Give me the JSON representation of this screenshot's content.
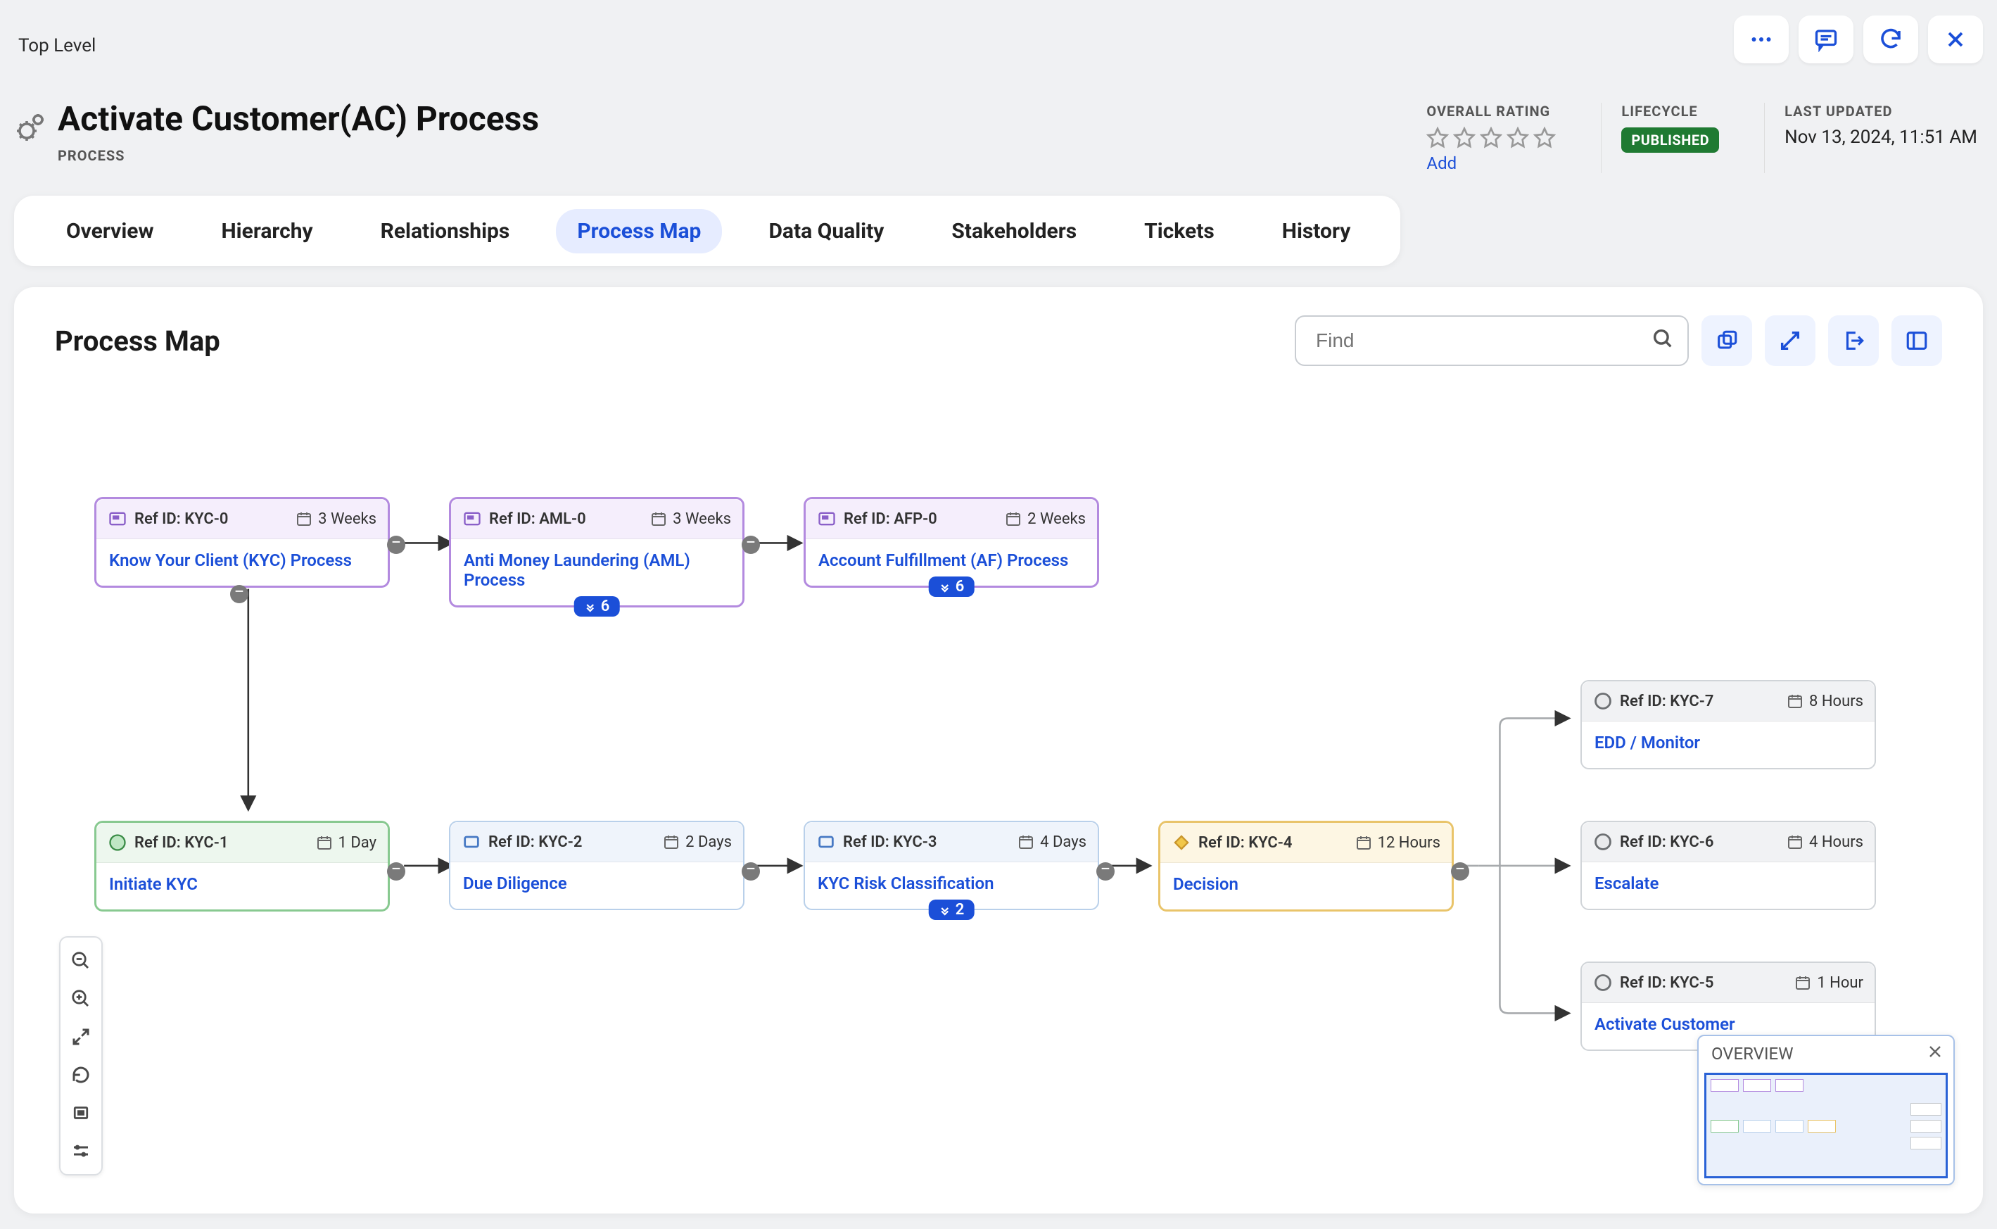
{
  "breadcrumb": "Top Level",
  "title": "Activate Customer(AC) Process",
  "subtype": "PROCESS",
  "meta": {
    "ratingLabel": "OVERALL RATING",
    "addLabel": "Add",
    "lifecycleLabel": "LIFECYCLE",
    "lifecycleValue": "PUBLISHED",
    "updatedLabel": "LAST UPDATED",
    "updatedValue": "Nov 13, 2024, 11:51 AM"
  },
  "tabs": [
    "Overview",
    "Hierarchy",
    "Relationships",
    "Process Map",
    "Data Quality",
    "Stakeholders",
    "Tickets",
    "History"
  ],
  "activeTab": "Process Map",
  "map": {
    "title": "Process Map",
    "findPlaceholder": "Find"
  },
  "nodes": {
    "kyc0": {
      "ref": "Ref ID: KYC-0",
      "dur": "3 Weeks",
      "name": "Know Your Client (KYC) Process",
      "badge": ""
    },
    "aml0": {
      "ref": "Ref ID: AML-0",
      "dur": "3 Weeks",
      "name": "Anti Money Laundering (AML) Process",
      "badge": "6"
    },
    "afp0": {
      "ref": "Ref ID: AFP-0",
      "dur": "2 Weeks",
      "name": "Account Fulfillment (AF) Process",
      "badge": "6"
    },
    "kyc1": {
      "ref": "Ref ID: KYC-1",
      "dur": "1 Day",
      "name": "Initiate KYC"
    },
    "kyc2": {
      "ref": "Ref ID: KYC-2",
      "dur": "2 Days",
      "name": "Due Diligence"
    },
    "kyc3": {
      "ref": "Ref ID: KYC-3",
      "dur": "4 Days",
      "name": "KYC Risk Classification",
      "badge": "2"
    },
    "kyc4": {
      "ref": "Ref ID: KYC-4",
      "dur": "12 Hours",
      "name": "Decision"
    },
    "kyc7": {
      "ref": "Ref ID: KYC-7",
      "dur": "8 Hours",
      "name": "EDD / Monitor"
    },
    "kyc6": {
      "ref": "Ref ID: KYC-6",
      "dur": "4 Hours",
      "name": "Escalate"
    },
    "kyc5": {
      "ref": "Ref ID: KYC-5",
      "dur": "1 Hour",
      "name": "Activate Customer"
    }
  },
  "overview": {
    "title": "OVERVIEW"
  }
}
